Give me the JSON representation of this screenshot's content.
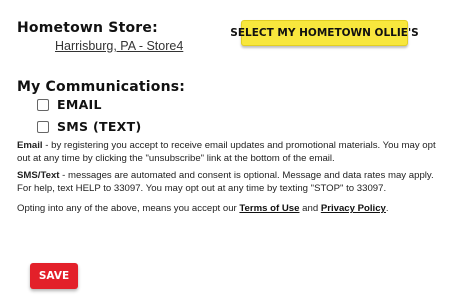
{
  "store": {
    "heading": "Hometown Store:",
    "current_store": "Harrisburg, PA - Store4",
    "select_button": "SELECT MY HOMETOWN OLLIE'S"
  },
  "communications": {
    "heading": "My Communications:",
    "options": [
      {
        "label": "EMAIL",
        "checked": false
      },
      {
        "label": "SMS (TEXT)",
        "checked": false
      }
    ]
  },
  "disclaimers": {
    "email_term": "Email",
    "email_text": " - by registering you accept to receive email updates and promotional materials. You may opt out at any time by clicking the \"unsubscribe\" link at the bottom of the email.",
    "sms_term": "SMS/Text",
    "sms_text": " - messages are automated and consent is optional. Message and data rates may apply. For help, text HELP to 33097. You may opt out at any time by texting \"STOP\" to 33097.",
    "optin_text": "Opting into any of the above, means you accept our ",
    "terms_link": "Terms of Use",
    "and_text": " and ",
    "privacy_link": "Privacy Policy",
    "period": "."
  },
  "actions": {
    "save_label": "SAVE"
  },
  "colors": {
    "select_button_bg": "#f8e73d",
    "save_button_bg": "#e3202a"
  }
}
